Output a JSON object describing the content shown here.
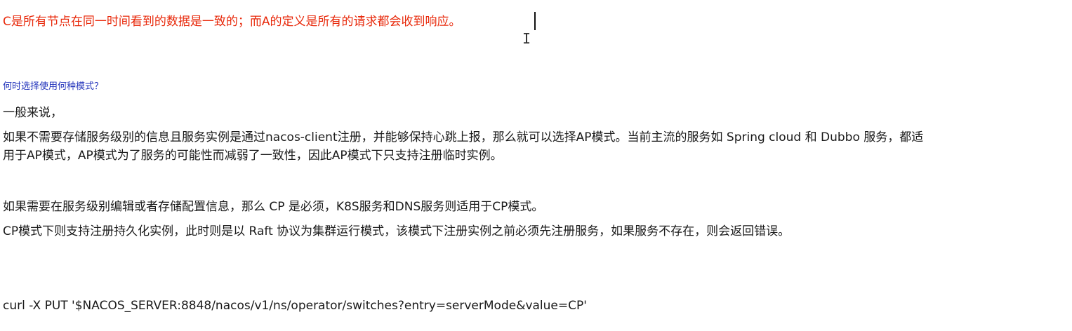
{
  "document": {
    "red_line": "C是所有节点在同一时间看到的数据是一致的；而A的定义是所有的请求都会收到响应。",
    "cursor_glyph": "I",
    "question": "何时选择使用何种模式？",
    "intro": "一般来说，",
    "ap_line_1": "如果不需要存储服务级别的信息且服务实例是通过nacos-client注册，并能够保持心跳上报，那么就可以选择AP模式。当前主流的服务如 Spring cloud 和 Dubbo 服务，都适",
    "ap_line_2": "用于AP模式，AP模式为了服务的可能性而减弱了一致性，因此AP模式下只支持注册临时实例。",
    "cp_line_1": "如果需要在服务级别编辑或者存储配置信息，那么 CP 是必须，K8S服务和DNS服务则适用于CP模式。",
    "cp_line_2": "CP模式下则支持注册持久化实例，此时则是以 Raft 协议为集群运行模式，该模式下注册实例之前必须先注册服务，如果服务不存在，则会返回错误。",
    "command": "curl -X PUT '$NACOS_SERVER:8848/nacos/v1/ns/operator/switches?entry=serverMode&value=CP'"
  },
  "colors": {
    "red_text": "#e8290b",
    "blue_text": "#2233bb",
    "body_text": "#1a1a1a"
  }
}
